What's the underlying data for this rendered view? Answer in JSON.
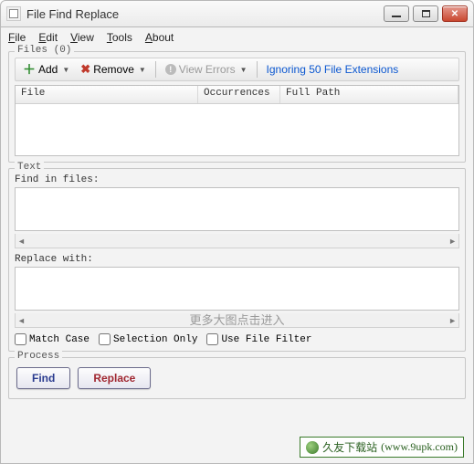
{
  "window": {
    "title": "File Find Replace"
  },
  "menubar": {
    "file": "File",
    "edit": "Edit",
    "view": "View",
    "tools": "Tools",
    "about": "About"
  },
  "files_group": {
    "label": "Files (0)",
    "toolbar": {
      "add": "Add",
      "remove": "Remove",
      "view_errors": "View Errors",
      "extensions": "Ignoring 50 File Extensions"
    },
    "columns": {
      "file": "File",
      "occurrences": "Occurrences",
      "fullpath": "Full Path"
    }
  },
  "text_group": {
    "label": "Text",
    "find_label": "Find in files:",
    "replace_label": "Replace with:",
    "find_value": "",
    "replace_value": "",
    "match_case": "Match Case",
    "selection_only": "Selection Only",
    "use_file_filter": "Use File Filter"
  },
  "process_group": {
    "label": "Process",
    "find_btn": "Find",
    "replace_btn": "Replace"
  },
  "watermark": {
    "center": "更多大图点击进入",
    "footer_name": "久友下载站",
    "footer_url": "(www.9upk.com)"
  }
}
